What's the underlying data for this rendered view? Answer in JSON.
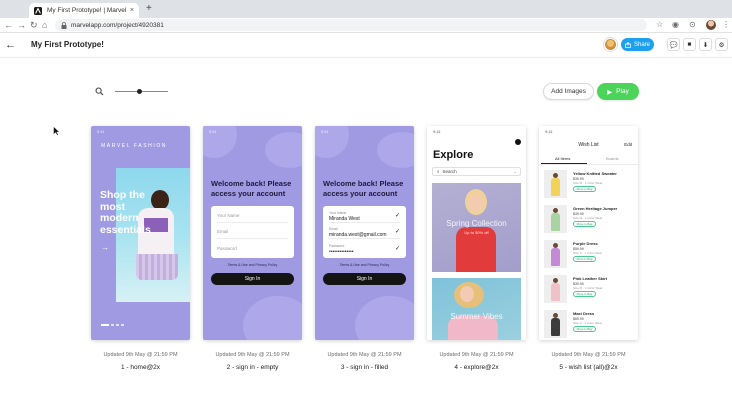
{
  "browser": {
    "tab_title": "My First Prototype! | Marvel",
    "tab_close": "×",
    "new_tab": "+",
    "url": "marvelapp.com/project/4920381"
  },
  "header": {
    "back": "←",
    "title": "My First Prototype!",
    "share_label": "Share"
  },
  "toolbar": {
    "add_images_label": "Add Images",
    "play_label": "Play",
    "zoom_level": 0.47
  },
  "screens": [
    {
      "status_time": "9:41",
      "brand": "MARVEL FASHION",
      "hero_text": "Shop the most modern essentials",
      "arrow": "→",
      "updated": "Updated 9th May @ 21:59 PM",
      "name": "1 - home@2x"
    },
    {
      "status_time": "9:41",
      "welcome": "Welcome back! Please access your account",
      "field_name": "Your Name",
      "field_email": "Email",
      "field_password": "Password",
      "terms": "Terms & Use and Privacy Policy",
      "signin": "Sign In",
      "updated": "Updated 9th May @ 21:59 PM",
      "name": "2 - sign in - empty"
    },
    {
      "status_time": "9:41",
      "welcome": "Welcome back! Please access your account",
      "label_name": "Your Name",
      "value_name": "Miranda West",
      "label_email": "Email",
      "value_email": "miranda.west@gmail.com",
      "label_password": "Password",
      "value_password": "••••••••••••••",
      "terms": "Terms & Use and Privacy Policy",
      "signin": "Sign In",
      "updated": "Updated 9th May @ 21:59 PM",
      "name": "3 - sign in - filled"
    },
    {
      "status_time": "9:41",
      "title": "Explore",
      "search": "Search",
      "card1": "Spring Collection",
      "card1_sub": "Up to 50% off",
      "card2": "Summer Vibes",
      "updated": "Updated 9th May @ 21:59 PM",
      "name": "4 - explore@2x"
    },
    {
      "status_time": "9:41",
      "header": "Wish List",
      "edit": "Edit",
      "tab_all": "All Items",
      "tab_boards": "Boards",
      "button": "Move to Bag",
      "items": [
        {
          "name": "Yellow Knitted Sweater",
          "price": "$39.99",
          "meta": "Size M · 1 Color Wear"
        },
        {
          "name": "Green Heritage Jumper",
          "price": "$49.99",
          "meta": "Size M · 1 Color Wear"
        },
        {
          "name": "Purple Dress",
          "price": "$59.99",
          "meta": "Size S · 1 Color Wear"
        },
        {
          "name": "Pink Leather Skirt",
          "price": "$39.99",
          "meta": "Size M · 1 Color Wear"
        },
        {
          "name": "Maxi Dress",
          "price": "$69.99",
          "meta": "Size S · 1 Color Wear"
        }
      ],
      "updated": "Updated 9th May @ 21:59 PM",
      "name": "5 - wish list (all)@2x"
    }
  ],
  "colors": {
    "screen_purple": "#a09ae3",
    "share_blue": "#1ea0f0",
    "play_green": "#4cd35a"
  }
}
